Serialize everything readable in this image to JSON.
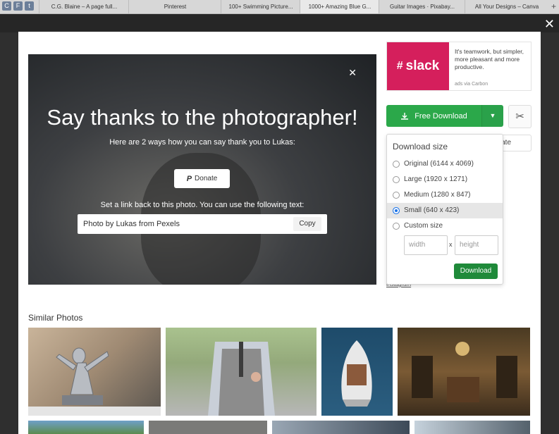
{
  "tabs": [
    {
      "label": "C.G. Blaine – A page full..."
    },
    {
      "label": "Pinterest"
    },
    {
      "label": "100+ Swimming Picture..."
    },
    {
      "label": "1000+ Amazing Blue G..."
    },
    {
      "label": "Guitar Images · Pixabay..."
    },
    {
      "label": "All Your Designs – Canva"
    }
  ],
  "favicons": [
    "C",
    "F",
    "t"
  ],
  "tab_plus": "+",
  "close_symbol": "✕",
  "overlay": {
    "close_symbol": "✕",
    "title": "Say thanks to the photographer!",
    "subtitle": "Here are 2 ways how you can say thank you to Lukas:",
    "donate_label": "Donate",
    "link_instruction": "Set a link back to this photo. You can use the following text:",
    "credit_text": "Photo by Lukas from Pexels",
    "copy_label": "Copy"
  },
  "ad": {
    "brand": "slack",
    "copy": "It's teamwork, but simpler, more pleasant and more productive.",
    "via": "ads via Carbon"
  },
  "download": {
    "button_label": "Free Download",
    "arrow": "▼",
    "donate_partial": "onate",
    "instagram_partial": "instagram"
  },
  "dropdown": {
    "title": "Download size",
    "options": [
      {
        "label": "Original (6144 x 4069)",
        "selected": false
      },
      {
        "label": "Large (1920 x 1271)",
        "selected": false
      },
      {
        "label": "Medium (1280 x 847)",
        "selected": false
      },
      {
        "label": "Small (640 x 423)",
        "selected": true
      },
      {
        "label": "Custom size",
        "selected": false
      }
    ],
    "width_placeholder": "width",
    "height_placeholder": "height",
    "x_sep": "x",
    "download_label": "Download"
  },
  "similar_title": "Similar Photos",
  "colors": {
    "accent_green": "#2ba84a",
    "slack_pink": "#d51f5c"
  }
}
